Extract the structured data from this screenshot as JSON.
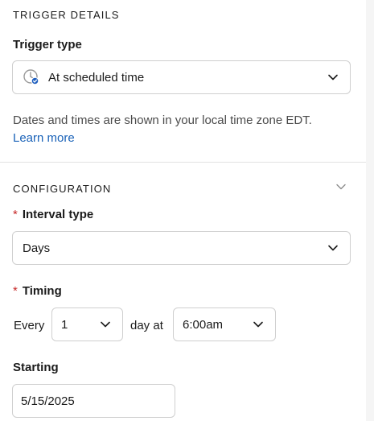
{
  "trigger_details": {
    "title": "TRIGGER DETAILS",
    "trigger_type_label": "Trigger type",
    "trigger_type_value": "At scheduled time",
    "timezone_hint": "Dates and times are shown in your local time zone EDT.",
    "learn_more": "Learn more"
  },
  "configuration": {
    "title": "CONFIGURATION",
    "interval_type_label": "Interval type",
    "interval_type_value": "Days",
    "timing_label": "Timing",
    "every_text": "Every",
    "every_value": "1",
    "day_at_text": "day at",
    "time_value": "6:00am",
    "starting_label": "Starting",
    "starting_value": "5/15/2025",
    "required_mark": "*"
  },
  "icons": {
    "trigger_icon": "clock-check-icon",
    "chevron": "chevron-down-icon"
  },
  "colors": {
    "link": "#1a62b8",
    "required": "#c62828",
    "border": "#cfcfcf",
    "check_badge": "#1f5fbf"
  }
}
